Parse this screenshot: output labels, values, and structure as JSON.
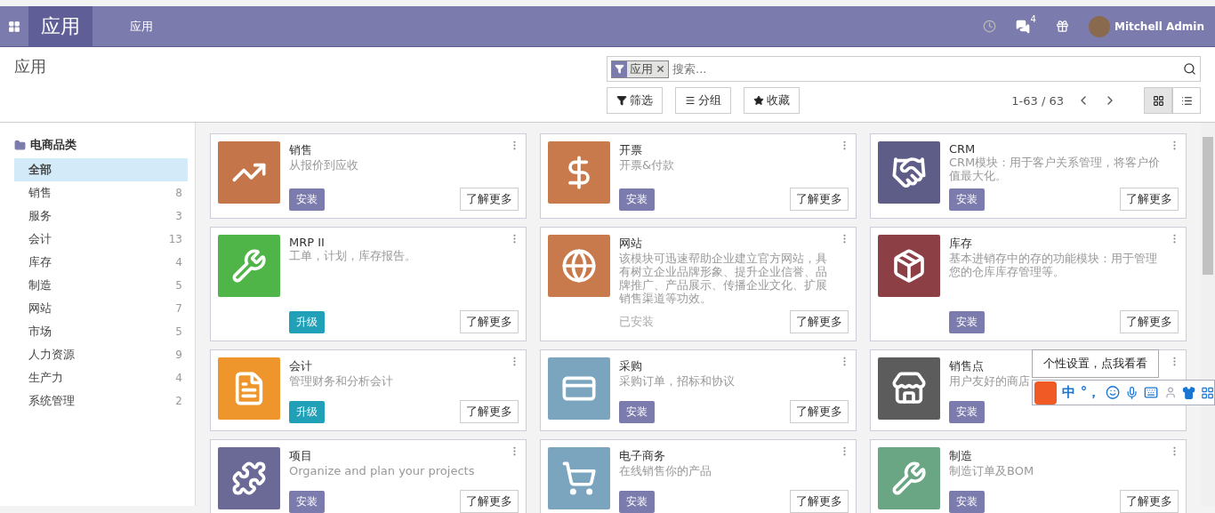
{
  "navbar": {
    "app_title": "应用",
    "menu": [
      {
        "label": "应用"
      }
    ],
    "messages_count": "4",
    "user": "Mitchell Admin"
  },
  "control_panel": {
    "breadcrumb": "应用",
    "search": {
      "facet": "应用",
      "placeholder": "搜索..."
    },
    "buttons": [
      {
        "kind": "filter",
        "label": "筛选"
      },
      {
        "kind": "group",
        "label": "分组"
      },
      {
        "kind": "favorite",
        "label": "收藏"
      }
    ],
    "pager": "1-63 / 63",
    "views": [
      {
        "kind": "kanban",
        "selected": true
      },
      {
        "kind": "list",
        "selected": false
      }
    ]
  },
  "sidebar": {
    "title": "电商品类",
    "items": [
      {
        "label": "全部",
        "selected": true
      },
      {
        "label": "销售",
        "count": "8",
        "selected": false
      },
      {
        "label": "服务",
        "count": "3",
        "selected": false
      },
      {
        "label": "会计",
        "count": "13",
        "selected": false
      },
      {
        "label": "库存",
        "count": "4",
        "selected": false
      },
      {
        "label": "制造",
        "count": "5",
        "selected": false
      },
      {
        "label": "网站",
        "count": "7",
        "selected": false
      },
      {
        "label": "市场",
        "count": "5",
        "selected": false
      },
      {
        "label": "人力资源",
        "count": "9",
        "selected": false
      },
      {
        "label": "生产力",
        "count": "4",
        "selected": false
      },
      {
        "label": "系统管理",
        "count": "2",
        "selected": false
      }
    ]
  },
  "apps": [
    {
      "kind": "chart",
      "color": "#c4764a",
      "name": "销售",
      "summary": "从报价到应收",
      "action": {
        "kind": "install",
        "label": "安装"
      },
      "learn_more": "了解更多"
    },
    {
      "kind": "invoice",
      "color": "#c97a4c",
      "name": "开票",
      "summary": "开票&付款",
      "action": {
        "kind": "install",
        "label": "安装"
      },
      "learn_more": "了解更多"
    },
    {
      "kind": "handshake",
      "color": "#5e5d88",
      "name": "CRM",
      "summary": "CRM模块：用于客户关系管理，将客户价值最大化。",
      "action": {
        "kind": "install",
        "label": "安装"
      },
      "learn_more": "了解更多"
    },
    {
      "kind": "wrench",
      "color": "#4fb548",
      "name": "MRP II",
      "summary": "工单，计划，库存报告。",
      "action": {
        "kind": "upgrade",
        "label": "升级"
      },
      "learn_more": "了解更多"
    },
    {
      "kind": "globe",
      "color": "#c97a4c",
      "name": "网站",
      "summary": "该模块可迅速帮助企业建立官方网站，具有树立企业品牌形象、提升企业信誉、品牌推广、产品展示、传播企业文化、扩展销售渠道等功效。",
      "action": {
        "kind": "installed",
        "label": "已安装"
      },
      "learn_more": "了解更多"
    },
    {
      "kind": "box",
      "color": "#8c4046",
      "name": "库存",
      "summary": "基本进销存中的存的功能模块：用于管理您的仓库库存管理等。",
      "action": {
        "kind": "install",
        "label": "安装"
      },
      "learn_more": "了解更多"
    },
    {
      "kind": "document",
      "color": "#ee962c",
      "name": "会计",
      "summary": "管理财务和分析会计",
      "action": {
        "kind": "upgrade",
        "label": "升级"
      },
      "learn_more": "了解更多"
    },
    {
      "kind": "card",
      "color": "#7ba5bf",
      "name": "采购",
      "summary": "采购订单，招标和协议",
      "action": {
        "kind": "install",
        "label": "安装"
      },
      "learn_more": "了解更多"
    },
    {
      "kind": "store",
      "color": "#5c5c5c",
      "name": "销售点",
      "summary": "用户友好的商店",
      "action": {
        "kind": "install",
        "label": "安装"
      }
    },
    {
      "kind": "puzzle",
      "color": "#6b6a96",
      "name": "项目",
      "summary": "Organize and plan your projects",
      "action": {
        "kind": "install",
        "label": "安装"
      },
      "learn_more": "了解更多"
    },
    {
      "kind": "cart",
      "color": "#7ba5bf",
      "name": "电子商务",
      "summary": "在线销售你的产品",
      "action": {
        "kind": "install",
        "label": "安装"
      },
      "learn_more": "了解更多"
    },
    {
      "kind": "wrench",
      "color": "#6aa683",
      "name": "制造",
      "summary": "制造订单及BOM",
      "action": {
        "kind": "install",
        "label": "安装"
      },
      "learn_more": "了解更多"
    }
  ],
  "ime": {
    "tooltip": "个性设置，点我看看",
    "mode": "中",
    "punct": "°，"
  }
}
